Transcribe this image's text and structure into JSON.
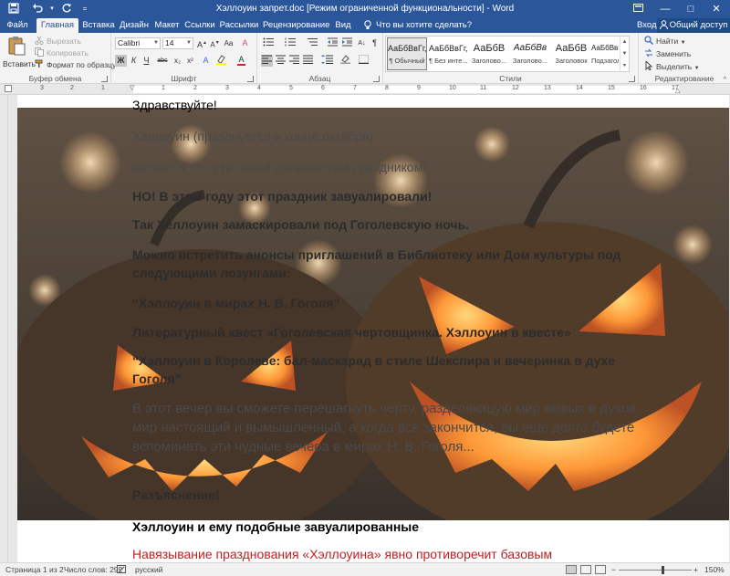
{
  "window": {
    "title": "Хэллоуин запрет.doc [Режим ограниченной функциональности] - Word",
    "controls": [
      "minimize",
      "maximize",
      "close"
    ]
  },
  "qat": {
    "save_icon": "save-icon",
    "undo_icon": "undo-icon",
    "redo_icon": "redo-icon"
  },
  "tabs": [
    {
      "label": "Файл"
    },
    {
      "label": "Главная"
    },
    {
      "label": "Вставка"
    },
    {
      "label": "Дизайн"
    },
    {
      "label": "Макет"
    },
    {
      "label": "Ссылки"
    },
    {
      "label": "Рассылки"
    },
    {
      "label": "Рецензирование"
    },
    {
      "label": "Вид"
    }
  ],
  "tellme": "Что вы хотите сделать?",
  "account": {
    "signin": "Вход",
    "share": "Общий доступ"
  },
  "ribbon": {
    "clipboard": {
      "paste": "Вставить",
      "cut": "Вырезать",
      "copy": "Копировать",
      "format_painter": "Формат по образцу",
      "label": "Буфер обмена"
    },
    "font": {
      "name": "Calibri",
      "size": "14",
      "bold": "Ж",
      "italic": "К",
      "underline": "Ч",
      "strike": "abc",
      "subscript": "x₂",
      "superscript": "x²",
      "label": "Шрифт"
    },
    "paragraph": {
      "label": "Абзац",
      "pilcrow": "¶"
    },
    "styles": {
      "label": "Стили",
      "items": [
        {
          "sample": "АаБбВвГг,",
          "name": "¶ Обычный"
        },
        {
          "sample": "АаБбВвГг,",
          "name": "¶ Без инте..."
        },
        {
          "sample": "АаБбВ",
          "name": "Заголово..."
        },
        {
          "sample": "АаБбВв",
          "name": "Заголово..."
        },
        {
          "sample": "АаБбВ",
          "name": "Заголовок"
        },
        {
          "sample": "АаБбВвГ",
          "name": "Подзагол..."
        }
      ]
    },
    "editing": {
      "find": "Найти",
      "replace": "Заменить",
      "select": "Выделить",
      "label": "Редактирование"
    }
  },
  "ruler": {
    "numbers": [
      "3",
      "2",
      "1",
      "1",
      "2",
      "3",
      "4",
      "5",
      "6",
      "7",
      "8",
      "9",
      "10",
      "11",
      "12",
      "13",
      "14",
      "15",
      "16",
      "17"
    ]
  },
  "document": {
    "paragraphs": [
      "Здравствуйте!",
      "Хэллоуин (празднуется в конце октября)",
      "является по сути своей сатанинским праздником!",
      "НО! В этом году этот праздник завуалировали!",
      "Так Хеллоуин замаскировали под Гоголевскую ночь.",
      "Можно встретить анонсы приглашений в Библиотеку или Дом культуры под следующими лозунгами:",
      "“Хэллоуин в мирах Н. В. Гоголя”",
      "Литературный квест «Гоголевская чертовщинка. Хэллоуин в квесте»",
      "“Хэллоуин в Королеве: бал-маскарад в стиле Шекспира и вечеринка в духе Гоголя”",
      "В этот вечер вы сможете перешагнуть черту, разделяющую мир живых и духов, мир настоящий и вымышленный, а когда все закончится, вы еще долго будете вспоминать эти чудные вечера в мирах Н. В. Гоголя...",
      "Разъяснение!",
      "Хэллоуин и ему подобные завуалированные",
      "Навязывание празднования «Хэллоуина» явно противоречит базовым"
    ]
  },
  "status": {
    "page": "Страница 1 из 2",
    "words": "Число слов: 292",
    "language": "русский",
    "zoom": "150%",
    "zoom_level": 0.6
  },
  "colors": {
    "accent": "#2b579a",
    "heading_red": "#c02020"
  }
}
